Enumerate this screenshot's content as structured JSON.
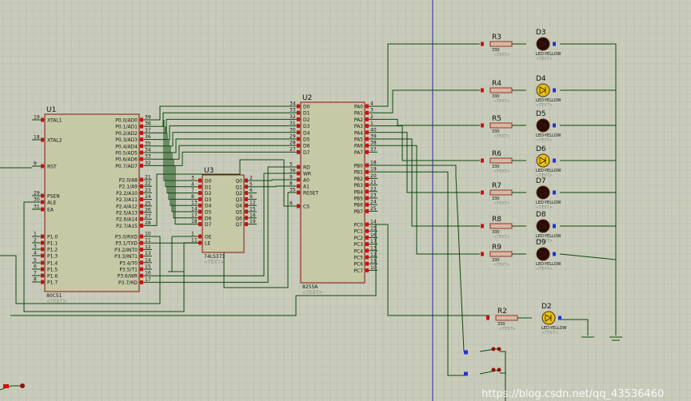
{
  "colors": {
    "background": "#c9ccbb",
    "grid_minor": "#b8bba9",
    "grid_major": "#a9ac9a",
    "wire": "#0d4a0d",
    "chip_fill": "#c6c9a6",
    "chip_border": "#8a1212",
    "pin_red": "#cc1111",
    "pin_blue": "#2233dd",
    "label_text": "#111111",
    "text_placeholder": "#8a8d7c",
    "led_dark": "#2a0808",
    "led_yellow": "#e8c010",
    "resistor_fill": "#d8b8a0",
    "axis_blue": "#2222aa",
    "watermark": "#ffffff"
  },
  "u1": {
    "ref": "U1",
    "part": "80C51",
    "text": "<TEXT>",
    "left_pins": [
      {
        "num": "19",
        "name": "XTAL1"
      },
      {
        "num": "18",
        "name": "XTAL2"
      },
      {
        "num": "9",
        "name": "RST"
      },
      {
        "num": "29",
        "name": "PSEN"
      },
      {
        "num": "30",
        "name": "ALE"
      },
      {
        "num": "31",
        "name": "EA"
      },
      {
        "num": "1",
        "name": "P1.0"
      },
      {
        "num": "2",
        "name": "P1.1"
      },
      {
        "num": "3",
        "name": "P1.2"
      },
      {
        "num": "4",
        "name": "P1.3"
      },
      {
        "num": "5",
        "name": "P1.4"
      },
      {
        "num": "6",
        "name": "P1.5"
      },
      {
        "num": "7",
        "name": "P1.6"
      },
      {
        "num": "8",
        "name": "P1.7"
      }
    ],
    "right_pins": [
      {
        "num": "39",
        "name": "P0.0/AD0"
      },
      {
        "num": "38",
        "name": "P0.1/AD1"
      },
      {
        "num": "37",
        "name": "P0.2/AD2"
      },
      {
        "num": "36",
        "name": "P0.3/AD3"
      },
      {
        "num": "35",
        "name": "P0.4/AD4"
      },
      {
        "num": "34",
        "name": "P0.5/AD5"
      },
      {
        "num": "33",
        "name": "P0.6/AD6"
      },
      {
        "num": "32",
        "name": "P0.7/AD7"
      },
      {
        "num": "21",
        "name": "P2.0/A8"
      },
      {
        "num": "22",
        "name": "P2.1/A9"
      },
      {
        "num": "23",
        "name": "P2.2/A10"
      },
      {
        "num": "24",
        "name": "P2.3/A11"
      },
      {
        "num": "25",
        "name": "P2.4/A12"
      },
      {
        "num": "26",
        "name": "P2.5/A13"
      },
      {
        "num": "27",
        "name": "P2.6/A14"
      },
      {
        "num": "28",
        "name": "P2.7/A15"
      },
      {
        "num": "10",
        "name": "P3.0/RXD"
      },
      {
        "num": "11",
        "name": "P3.1/TXD"
      },
      {
        "num": "12",
        "name": "P3.2/INT0"
      },
      {
        "num": "13",
        "name": "P3.3/INT1"
      },
      {
        "num": "14",
        "name": "P3.4/T0"
      },
      {
        "num": "15",
        "name": "P3.5/T1"
      },
      {
        "num": "16",
        "name": "P3.6/WR"
      },
      {
        "num": "17",
        "name": "P3.7/RD"
      }
    ]
  },
  "u3": {
    "ref": "U3",
    "part": "74LS373",
    "text": "<TEXT>",
    "left_pins": [
      {
        "num": "3",
        "name": "D0"
      },
      {
        "num": "4",
        "name": "D1"
      },
      {
        "num": "7",
        "name": "D2"
      },
      {
        "num": "8",
        "name": "D3"
      },
      {
        "num": "13",
        "name": "D4"
      },
      {
        "num": "14",
        "name": "D5"
      },
      {
        "num": "17",
        "name": "D6"
      },
      {
        "num": "18",
        "name": "D7"
      },
      {
        "num": "1",
        "name": "OE"
      },
      {
        "num": "11",
        "name": "LE"
      }
    ],
    "right_pins": [
      {
        "num": "2",
        "name": "Q0"
      },
      {
        "num": "5",
        "name": "Q1"
      },
      {
        "num": "6",
        "name": "Q2"
      },
      {
        "num": "9",
        "name": "Q3"
      },
      {
        "num": "12",
        "name": "Q4"
      },
      {
        "num": "15",
        "name": "Q5"
      },
      {
        "num": "16",
        "name": "Q6"
      },
      {
        "num": "19",
        "name": "Q7"
      }
    ]
  },
  "u2": {
    "ref": "U2",
    "part": "8255A",
    "text": "<TEXT>",
    "left_pins": [
      {
        "num": "34",
        "name": "D0"
      },
      {
        "num": "33",
        "name": "D1"
      },
      {
        "num": "32",
        "name": "D2"
      },
      {
        "num": "31",
        "name": "D3"
      },
      {
        "num": "30",
        "name": "D4"
      },
      {
        "num": "29",
        "name": "D5"
      },
      {
        "num": "28",
        "name": "D6"
      },
      {
        "num": "27",
        "name": "D7"
      },
      {
        "num": "5",
        "name": "RD"
      },
      {
        "num": "36",
        "name": "WR"
      },
      {
        "num": "9",
        "name": "A0"
      },
      {
        "num": "8",
        "name": "A1"
      },
      {
        "num": "35",
        "name": "RESET"
      },
      {
        "num": "6",
        "name": "CS"
      }
    ],
    "right_pins": [
      {
        "num": "4",
        "name": "PA0"
      },
      {
        "num": "3",
        "name": "PA1"
      },
      {
        "num": "2",
        "name": "PA2"
      },
      {
        "num": "1",
        "name": "PA3"
      },
      {
        "num": "40",
        "name": "PA4"
      },
      {
        "num": "39",
        "name": "PA5"
      },
      {
        "num": "38",
        "name": "PA6"
      },
      {
        "num": "37",
        "name": "PA7"
      },
      {
        "num": "18",
        "name": "PB0"
      },
      {
        "num": "19",
        "name": "PB1"
      },
      {
        "num": "20",
        "name": "PB2"
      },
      {
        "num": "21",
        "name": "PB3"
      },
      {
        "num": "22",
        "name": "PB4"
      },
      {
        "num": "23",
        "name": "PB5"
      },
      {
        "num": "24",
        "name": "PB6"
      },
      {
        "num": "25",
        "name": "PB7"
      },
      {
        "num": "14",
        "name": "PC0"
      },
      {
        "num": "15",
        "name": "PC1"
      },
      {
        "num": "16",
        "name": "PC2"
      },
      {
        "num": "17",
        "name": "PC3"
      },
      {
        "num": "13",
        "name": "PC4"
      },
      {
        "num": "12",
        "name": "PC5"
      },
      {
        "num": "11",
        "name": "PC6"
      },
      {
        "num": "10",
        "name": "PC7"
      }
    ]
  },
  "leds": [
    {
      "res": "R3",
      "res_value": "330",
      "led": "D3",
      "led_part": "LED-YELLOW",
      "lit": false
    },
    {
      "res": "R4",
      "res_value": "330",
      "led": "D4",
      "led_part": "LED-YELLOW",
      "lit": true
    },
    {
      "res": "R5",
      "res_value": "330",
      "led": "D5",
      "led_part": "LED-YELLOW",
      "lit": false
    },
    {
      "res": "R6",
      "res_value": "330",
      "led": "D6",
      "led_part": "LED-YELLOW",
      "lit": true
    },
    {
      "res": "R7",
      "res_value": "330",
      "led": "D7",
      "led_part": "LED-YELLOW",
      "lit": false
    },
    {
      "res": "R8",
      "res_value": "330",
      "led": "D8",
      "led_part": "LED-YELLOW",
      "lit": false
    },
    {
      "res": "R9",
      "res_value": "330",
      "led": "D9",
      "led_part": "LED-YELLOW",
      "lit": false
    },
    {
      "res": "R2",
      "res_value": "330",
      "led": "D2",
      "led_part": "LED-YELLOW",
      "lit": true
    }
  ],
  "text_placeholder": "<TEXT>",
  "watermark": "https://blog.csdn.net/qq_43536460"
}
